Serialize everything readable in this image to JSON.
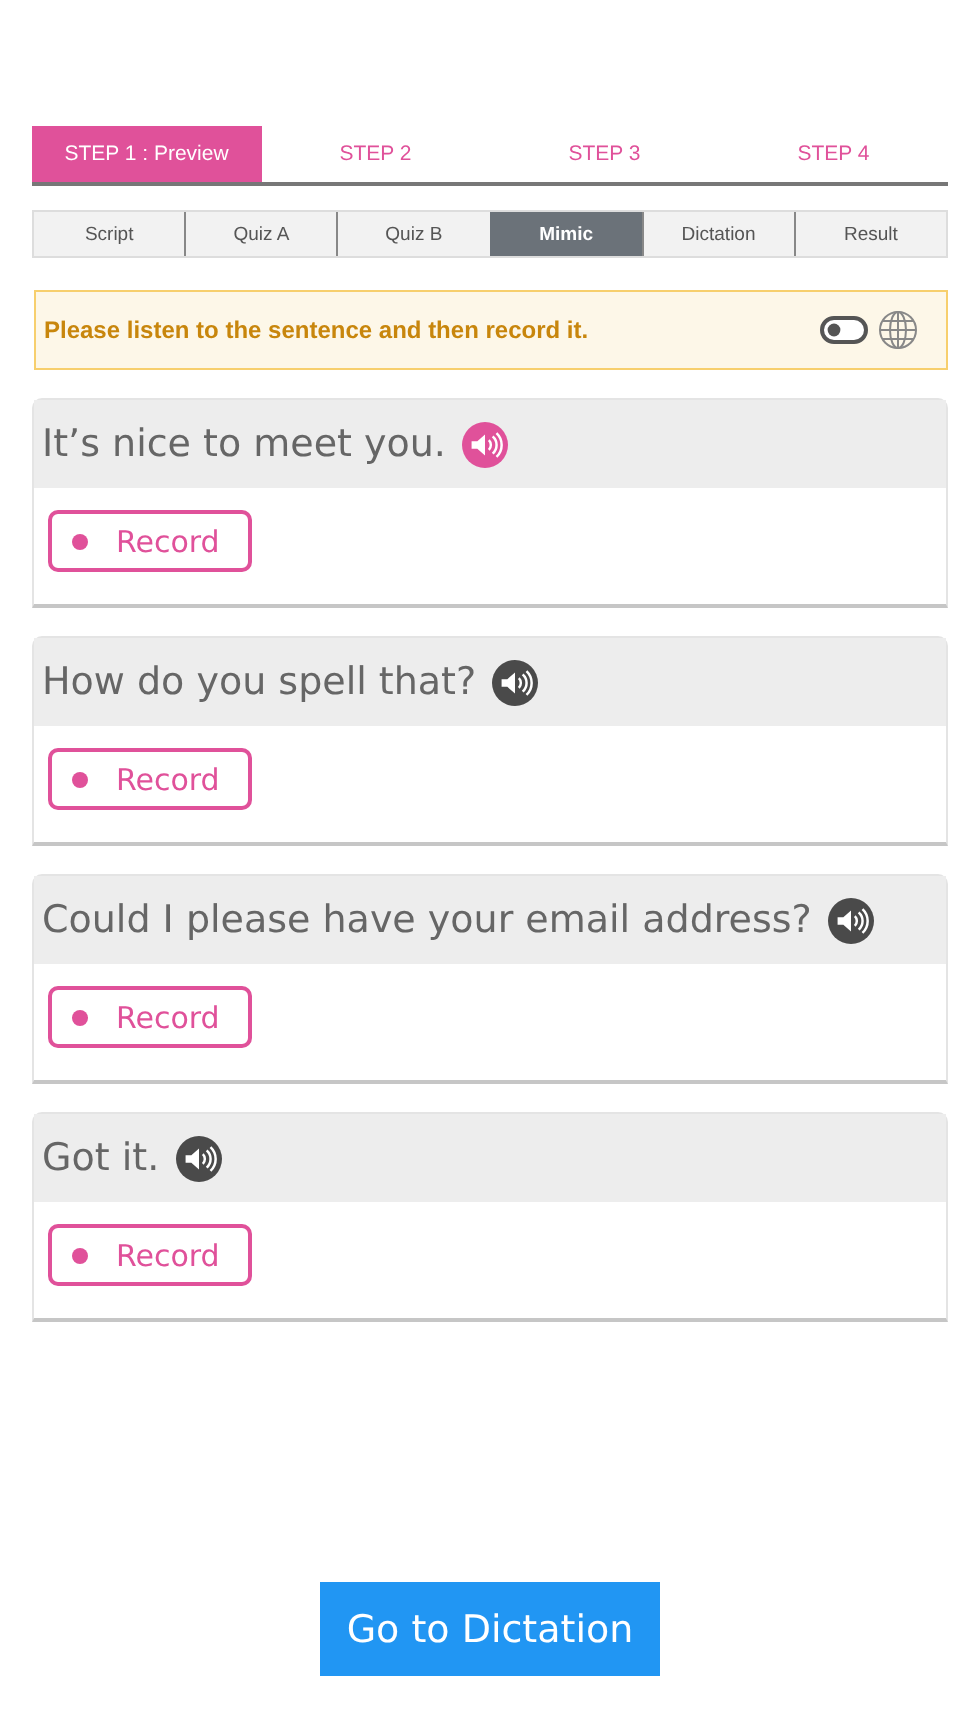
{
  "steps": [
    {
      "label": "STEP 1 : Preview",
      "selected": true
    },
    {
      "label": "STEP 2",
      "selected": false
    },
    {
      "label": "STEP 3",
      "selected": false
    },
    {
      "label": "STEP 4",
      "selected": false
    }
  ],
  "tabs": [
    {
      "label": "Script",
      "selected": false
    },
    {
      "label": "Quiz A",
      "selected": false
    },
    {
      "label": "Quiz B",
      "selected": false
    },
    {
      "label": "Mimic",
      "selected": true
    },
    {
      "label": "Dictation",
      "selected": false
    },
    {
      "label": "Result",
      "selected": false
    }
  ],
  "notice": {
    "text": "Please listen to the sentence and then record it.",
    "toggle_on": false
  },
  "sentences": [
    {
      "text": "It’s nice to meet you.",
      "playing": true,
      "button": "Record"
    },
    {
      "text": "How do you spell that?",
      "playing": false,
      "button": "Record"
    },
    {
      "text": "Could I please have your email address?",
      "playing": false,
      "button": "Record"
    },
    {
      "text": "Got it.",
      "playing": false,
      "button": "Record"
    }
  ],
  "next_button": "Go to Dictation"
}
